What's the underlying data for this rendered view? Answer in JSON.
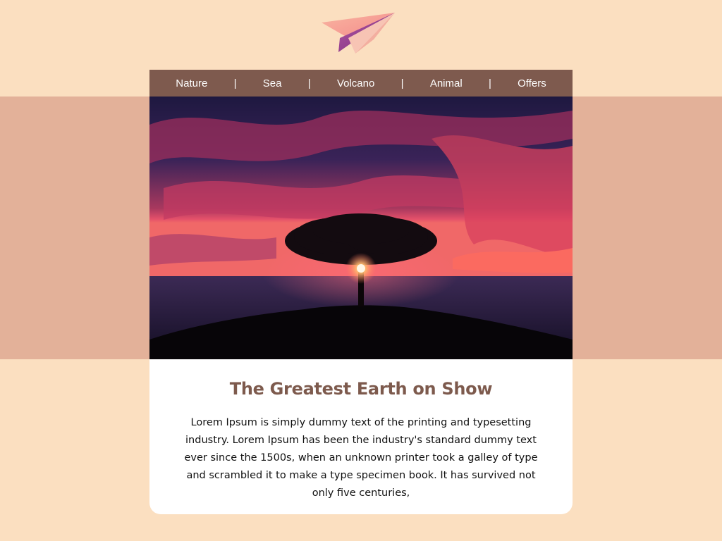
{
  "brand": {
    "logo_icon": "paper-plane-icon",
    "logo_colors": [
      "#f5a08a",
      "#8e3a86",
      "#f8c2b2"
    ]
  },
  "nav": {
    "items": [
      "Nature",
      "Sea",
      "Volcano",
      "Animal",
      "Offers"
    ],
    "separator": "|"
  },
  "hero": {
    "image": "sunset-tree-over-sea"
  },
  "article": {
    "title": "The Greatest Earth on Show",
    "body": "Lorem Ipsum is simply dummy text of the printing and typesetting industry. Lorem Ipsum has been the industry's standard dummy text ever since the 1500s, when an unknown printer took a galley of type and scrambled it to make a type specimen book. It has survived not only five centuries,"
  },
  "colors": {
    "page_bg": "#fbdfc0",
    "band_bg": "#e3b199",
    "nav_bg": "#7e5a4e",
    "title": "#7d5a4d"
  }
}
